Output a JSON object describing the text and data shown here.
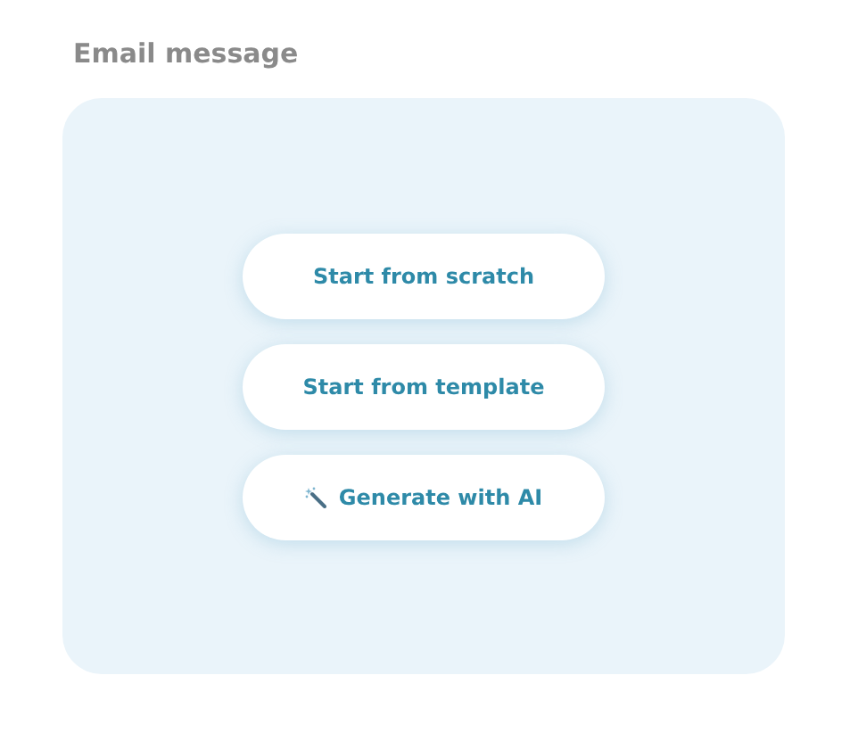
{
  "title": "Email message",
  "options": [
    {
      "label": "Start from scratch",
      "kind": "plain"
    },
    {
      "label": "Start from template",
      "kind": "plain"
    },
    {
      "label": "Generate with AI",
      "kind": "ai"
    }
  ]
}
